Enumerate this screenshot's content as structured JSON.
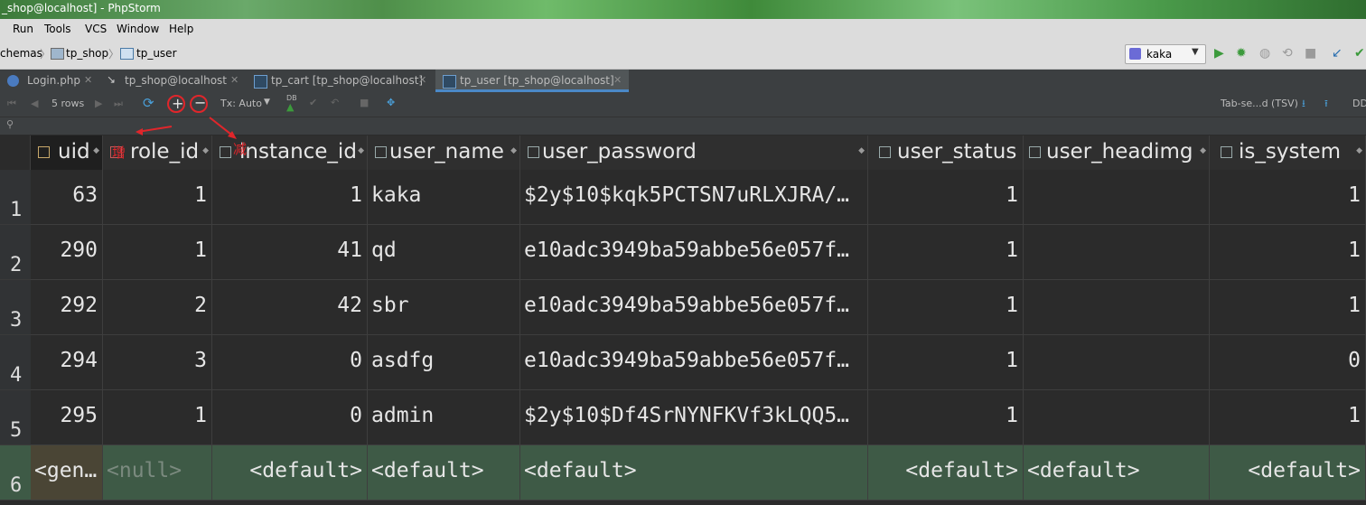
{
  "window": {
    "title": "_shop@localhost] - PhpStorm"
  },
  "menu": [
    "Run",
    "Tools",
    "VCS",
    "Window",
    "Help"
  ],
  "breadcrumb": {
    "item0": "chemas",
    "item1": "tp_shop",
    "item2": "tp_user"
  },
  "run_config": {
    "label": "kaka"
  },
  "tabs": [
    {
      "label": "Login.php"
    },
    {
      "label": "tp_shop@localhost"
    },
    {
      "label": "tp_cart [tp_shop@localhost]"
    },
    {
      "label": "tp_user [tp_shop@localhost]"
    }
  ],
  "data_toolbar": {
    "rows_label": "5 rows",
    "tx_label": "Tx: Auto",
    "db_label": "DB",
    "export_label": "Tab-se...d (TSV)",
    "right_label": "DD"
  },
  "annotations": {
    "mark1": "增",
    "mark2": "减"
  },
  "columns": [
    "uid",
    "role_id",
    "instance_id",
    "user_name",
    "user_password",
    "user_status",
    "user_headimg",
    "is_system"
  ],
  "rows": [
    {
      "num": "1",
      "cells": [
        "63",
        "1",
        "1",
        "kaka",
        "$2y$10$kqk5PCTSN7uRLXJRA/…",
        "1",
        "",
        "1"
      ]
    },
    {
      "num": "2",
      "cells": [
        "290",
        "1",
        "41",
        "qd",
        "e10adc3949ba59abbe56e057f…",
        "1",
        "",
        "1"
      ]
    },
    {
      "num": "3",
      "cells": [
        "292",
        "2",
        "42",
        "sbr",
        "e10adc3949ba59abbe56e057f…",
        "1",
        "",
        "1"
      ]
    },
    {
      "num": "4",
      "cells": [
        "294",
        "3",
        "0",
        "asdfg",
        "e10adc3949ba59abbe56e057f…",
        "1",
        "",
        "0"
      ]
    },
    {
      "num": "5",
      "cells": [
        "295",
        "1",
        "0",
        "admin",
        "$2y$10$Df4SrNYNFKVf3kLQQ5…",
        "1",
        "",
        "1"
      ]
    }
  ],
  "new_row": {
    "num": "6",
    "cells": [
      "<gen…",
      "<null>",
      "<default>",
      "<default>",
      "<default>",
      "<default>",
      "<default>",
      "<default>"
    ]
  }
}
